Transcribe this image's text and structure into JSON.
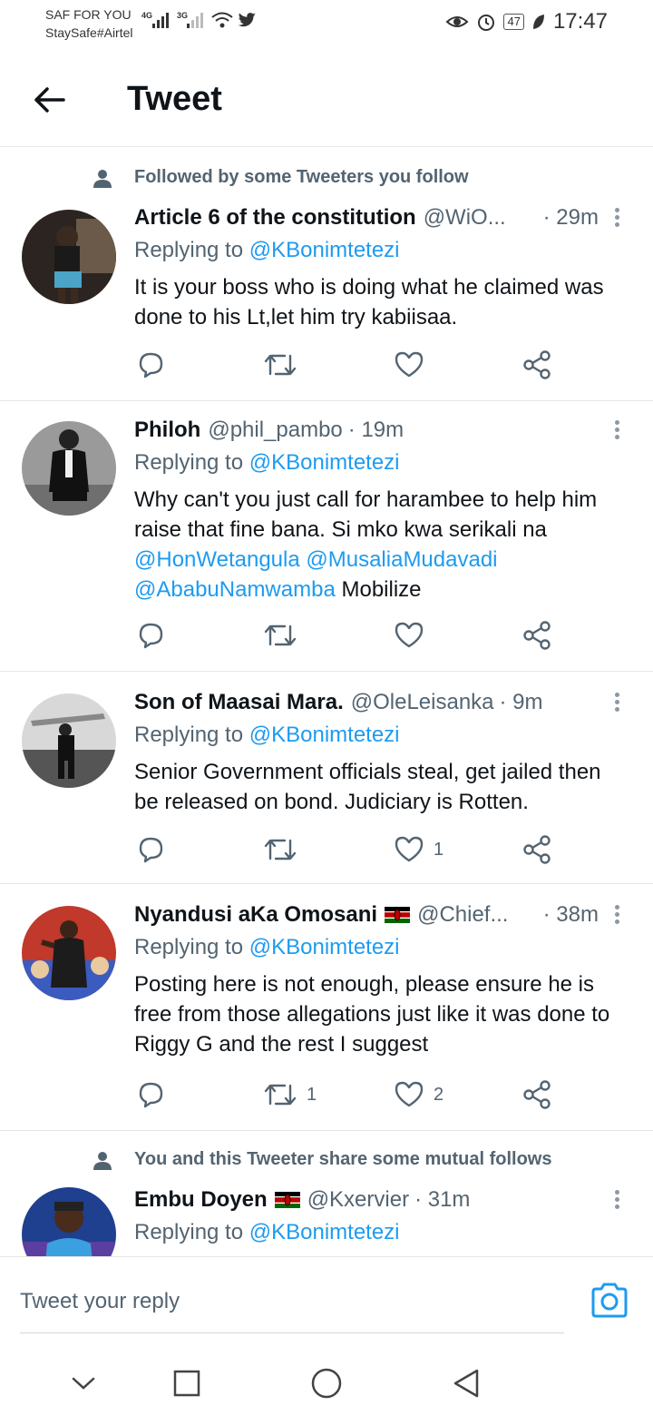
{
  "status_bar": {
    "carrier_line1": "SAF FOR YOU",
    "carrier_line2": "StaySafe#Airtel",
    "net1": "4G",
    "net2": "3G",
    "battery": "47",
    "time": "17:47"
  },
  "header": {
    "title": "Tweet"
  },
  "reply_prefix": "Replying to ",
  "tweets": [
    {
      "context": "Followed by some Tweeters you follow",
      "name": "Article 6 of the constitution",
      "handle": "@WiO...",
      "time": "· 29m",
      "replying_to": "@KBonimtetezi",
      "text": "It is your boss  who is doing what he claimed was done to his Lt,let him try kabiisaa.",
      "retweets": "",
      "likes": ""
    },
    {
      "name": "Philoh",
      "handle": "@phil_pambo",
      "time": "· 19m",
      "replying_to": "@KBonimtetezi",
      "text_prefix": "Why can't you just call for harambee to help him raise that fine bana. Si mko kwa serikali na ",
      "mention1": "@HonWetangula",
      "mention2": "@MusaliaMudavadi",
      "mention3": "@AbabuNamwamba",
      "text_suffix": " Mobilize",
      "retweets": "",
      "likes": ""
    },
    {
      "name": "Son of Maasai Mara.",
      "handle": "@OleLeisanka",
      "time": "· 9m",
      "replying_to": "@KBonimtetezi",
      "text": "Senior Government officials steal, get jailed then be released on bond. Judiciary is Rotten.",
      "retweets": "",
      "likes": "1"
    },
    {
      "name": "Nyandusi aKa Omosani",
      "handle": "@Chief...",
      "time": "· 38m",
      "replying_to": "@KBonimtetezi",
      "text": "Posting here is not enough, please ensure he is free from those allegations just like it was done to Riggy G and the rest I suggest",
      "retweets": "1",
      "likes": "2"
    },
    {
      "context": "You and this Tweeter share some mutual follows",
      "name": "Embu Doyen",
      "handle": "@Kxervier",
      "time": "· 31m",
      "replying_to": "@KBonimtetezi"
    }
  ],
  "reply_bar": {
    "placeholder": "Tweet your reply"
  },
  "icons": {
    "back": "arrow-left-icon",
    "reply": "speech-bubble-icon",
    "retweet": "retweet-icon",
    "like": "heart-icon",
    "share": "share-icon",
    "more": "more-vertical-icon",
    "camera": "camera-icon"
  },
  "colors": {
    "accent": "#1d9bf0",
    "muted": "#536471",
    "text": "#0f1419"
  }
}
